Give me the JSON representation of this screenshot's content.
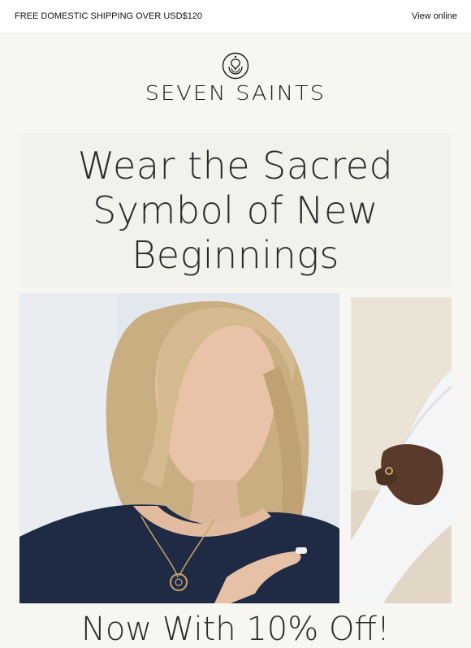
{
  "topbar": {
    "shipping_text": "FREE DOMESTIC SHIPPING OVER USD$120",
    "view_online": "View online"
  },
  "brand": {
    "logo_icon": "seven-saints-emblem-icon",
    "name": "SEVEN SAINTS"
  },
  "hero": {
    "headline": "Wear the Sacred Symbol of New Beginnings"
  },
  "images": {
    "main": "woman-wearing-flower-of-life-necklace",
    "side": "hand-with-gold-ring-on-white-sleeve"
  },
  "subhead": {
    "text": "Now With 10% Off!"
  },
  "colors": {
    "background": "#f7f6f2",
    "topbar": "#ffffff",
    "text": "#2a2a2a",
    "shirt": "#1f2a44",
    "gold": "#c9a46a"
  }
}
